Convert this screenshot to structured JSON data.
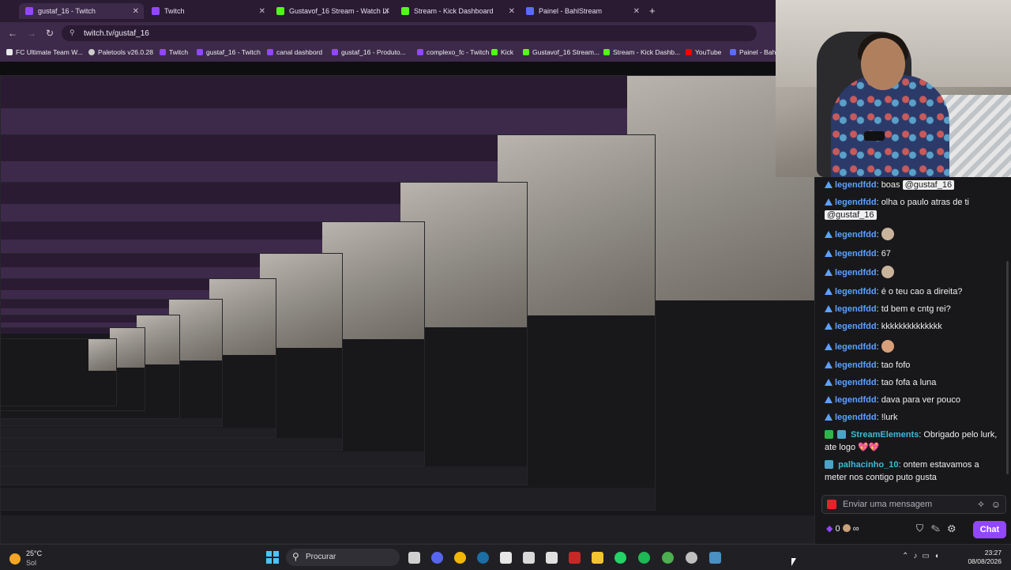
{
  "browser": {
    "tabs": [
      {
        "label": "gustaf_16 - Twitch",
        "color": "#9147ff",
        "active": true
      },
      {
        "label": "Twitch",
        "color": "#9147ff",
        "active": false
      },
      {
        "label": "Gustavof_16 Stream - Watch Li",
        "color": "#53fc18",
        "active": false
      },
      {
        "label": "Stream - Kick Dashboard",
        "color": "#53fc18",
        "active": false
      },
      {
        "label": "Painel - BahlStream",
        "color": "#5a6bff",
        "active": false
      }
    ],
    "new_tab": "+",
    "back": "←",
    "forward": "→",
    "reload": "↻",
    "url": "twitch.tv/gustaf_16",
    "bookmarks": [
      {
        "label": "FC Ultimate Team W...",
        "color": "#e8e8e8"
      },
      {
        "label": "Paletools v26.0.28",
        "color": "#cccccc"
      },
      {
        "label": "Twitch",
        "color": "#9147ff"
      },
      {
        "label": "gustaf_16 - Twitch",
        "color": "#9147ff"
      },
      {
        "label": "canal dashbord",
        "color": "#9147ff"
      },
      {
        "label": "gustaf_16 - Produto...",
        "color": "#9147ff"
      },
      {
        "label": "complexo_fc - Twitch",
        "color": "#9147ff"
      },
      {
        "label": "Kick",
        "color": "#53fc18"
      },
      {
        "label": "Gustavof_16 Stream...",
        "color": "#53fc18"
      },
      {
        "label": "Stream - Kick Dashb...",
        "color": "#53fc18"
      },
      {
        "label": "YouTube",
        "color": "#ff0000"
      },
      {
        "label": "Painel - Bahl",
        "color": "#5a6bff"
      }
    ]
  },
  "chat": {
    "messages": [
      {
        "user": "legendfdd",
        "text": "boas",
        "mention": "@gustaf_16",
        "badge": "tri"
      },
      {
        "user": "legendfdd",
        "text": "olha o paulo atras de ti",
        "mention": "@gustaf_16",
        "badge": "tri"
      },
      {
        "user": "legendfdd",
        "text": "",
        "emote": true,
        "badge": "tri"
      },
      {
        "user": "legendfdd",
        "text": "67",
        "badge": "tri"
      },
      {
        "user": "legendfdd",
        "text": "",
        "emote": true,
        "badge": "tri"
      },
      {
        "user": "legendfdd",
        "text": "é o teu cao a direita?",
        "badge": "tri"
      },
      {
        "user": "legendfdd",
        "text": "td bem e cntg rei?",
        "badge": "tri"
      },
      {
        "user": "legendfdd",
        "text": "kkkkkkkkkkkkkk",
        "badge": "tri"
      },
      {
        "user": "legendfdd",
        "text": "",
        "emote": true,
        "badge": "tri"
      },
      {
        "user": "legendfdd",
        "text": "tao fofo",
        "badge": "tri"
      },
      {
        "user": "legendfdd",
        "text": "tao fofa a luna",
        "badge": "tri"
      },
      {
        "user": "legendfdd",
        "text": "dava para ver pouco",
        "badge": "tri"
      },
      {
        "user": "legendfdd",
        "text": "!lurk",
        "badge": "tri"
      },
      {
        "user": "StreamElements",
        "text": "Obrigado pelo lurk, ate logo",
        "hearts": "💖💖",
        "badge": "se"
      },
      {
        "user": "palhacinho_10",
        "text": "ontem estavamos a meter nos contigo puto gusta",
        "badge": "tv"
      }
    ],
    "input_placeholder": "Enviar uma mensagem",
    "points": "0",
    "points_symbol": "∞",
    "chat_button": "Chat",
    "accent": "#9147ff"
  },
  "taskbar": {
    "weather_temp": "25°C",
    "weather_cond": "Sol",
    "search_label": "Procurar",
    "time": "23:27",
    "date": "08/08/2026",
    "pinned": [
      {
        "name": "task-view-icon",
        "color": "#d0d0d0"
      },
      {
        "name": "discord-icon",
        "color": "#5865f2"
      },
      {
        "name": "chrome-icon",
        "color": "#f2b705"
      },
      {
        "name": "steam-icon",
        "color": "#1b6fa6"
      },
      {
        "name": "epic-games-icon",
        "color": "#e6e6e6"
      },
      {
        "name": "ea-icon",
        "color": "#d9d9d9"
      },
      {
        "name": "capcut-icon",
        "color": "#e0e0e0"
      },
      {
        "name": "obs-icon",
        "color": "#c62828"
      },
      {
        "name": "file-explorer-icon",
        "color": "#f4c430"
      },
      {
        "name": "whatsapp-icon",
        "color": "#25d366"
      },
      {
        "name": "spotify-icon",
        "color": "#1db954"
      },
      {
        "name": "chrome-profile-icon",
        "color": "#4caf50"
      },
      {
        "name": "kick-app-icon",
        "color": "#bfbfbf"
      },
      {
        "name": "app-icon",
        "color": "#4a90c2"
      }
    ]
  }
}
